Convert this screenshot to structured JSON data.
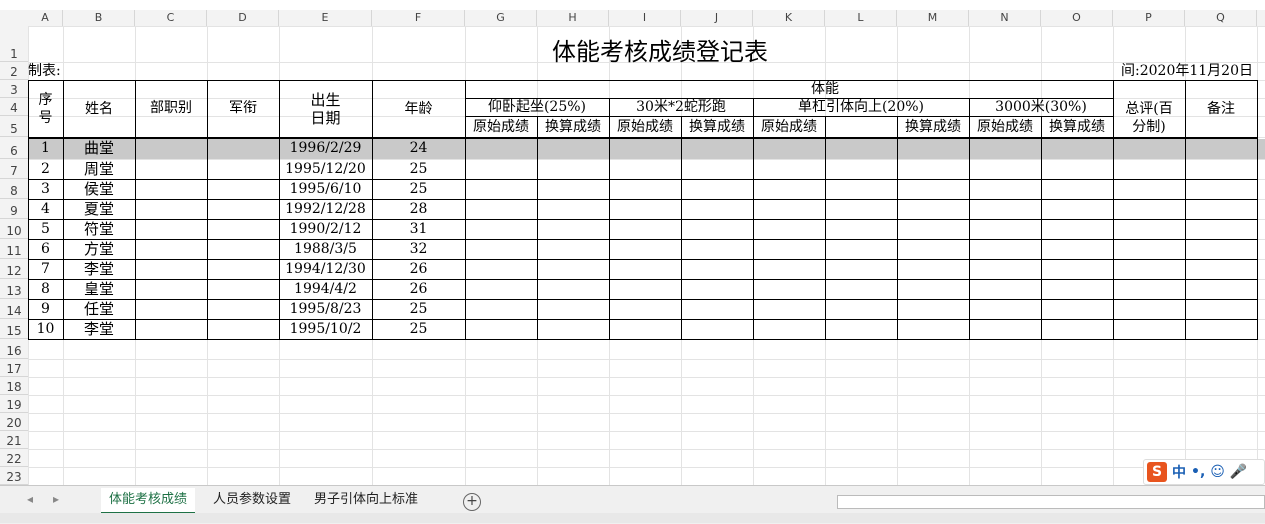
{
  "columns": [
    "A",
    "B",
    "C",
    "D",
    "E",
    "F",
    "G",
    "H",
    "I",
    "J",
    "K",
    "L",
    "M",
    "N",
    "O",
    "P",
    "Q"
  ],
  "rows": [
    "1",
    "2",
    "3",
    "4",
    "5",
    "6",
    "7",
    "8",
    "9",
    "10",
    "11",
    "12",
    "13",
    "14",
    "15",
    "16",
    "17",
    "18",
    "19",
    "20",
    "21",
    "22",
    "23"
  ],
  "sheet": {
    "title": "体能考核成绩登记表",
    "maker_label": "制表:",
    "date_label": "间:2020年11月20日",
    "headers": {
      "seq": "序\n号",
      "name": "姓名",
      "dept": "部职别",
      "rank": "军衔",
      "birth": "出生\n日期",
      "age": "年龄",
      "fitness": "体能",
      "situp": "仰卧起坐(25%)",
      "run30": "30米*2蛇形跑",
      "pullup": "单杠引体向上(20%)",
      "run3000": "3000米(30%)",
      "total": "总评(百\n分制)",
      "remark": "备注",
      "raw": "原始成绩",
      "conv": "换算成绩"
    },
    "records": [
      {
        "seq": "1",
        "name": "曲堂",
        "birth": "1996/2/29",
        "age": "24"
      },
      {
        "seq": "2",
        "name": "周堂",
        "birth": "1995/12/20",
        "age": "25"
      },
      {
        "seq": "3",
        "name": "侯堂",
        "birth": "1995/6/10",
        "age": "25"
      },
      {
        "seq": "4",
        "name": "夏堂",
        "birth": "1992/12/28",
        "age": "28"
      },
      {
        "seq": "5",
        "name": "符堂",
        "birth": "1990/2/12",
        "age": "31"
      },
      {
        "seq": "6",
        "name": "方堂",
        "birth": "1988/3/5",
        "age": "32"
      },
      {
        "seq": "7",
        "name": "李堂",
        "birth": "1994/12/30",
        "age": "26"
      },
      {
        "seq": "8",
        "name": "皇堂",
        "birth": "1994/4/2",
        "age": "26"
      },
      {
        "seq": "9",
        "name": "任堂",
        "birth": "1995/8/23",
        "age": "25"
      },
      {
        "seq": "10",
        "name": "李堂",
        "birth": "1995/10/2",
        "age": "25"
      }
    ]
  },
  "tabs": [
    "体能考核成绩",
    "人员参数设置",
    "男子引体向上标准"
  ],
  "active_tab_index": 0,
  "ime": {
    "logo": "S",
    "mode": "中"
  },
  "colors": {
    "accent": "#1e7145",
    "selection": "#c9c9c9"
  }
}
